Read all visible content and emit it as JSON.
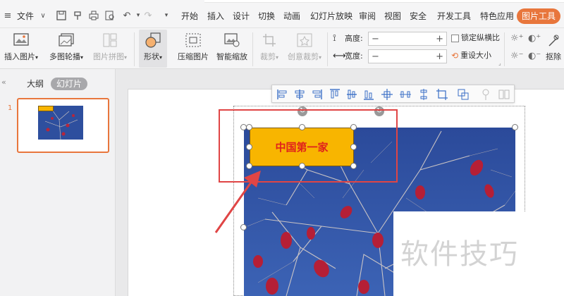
{
  "menubar": {
    "file_label": "文件",
    "items": [
      "开始",
      "插入",
      "设计",
      "切换",
      "动画",
      "幻灯片放映",
      "审阅",
      "视图",
      "安全",
      "开发工具",
      "特色应用"
    ],
    "picture_tools_tab": "图片工具"
  },
  "ribbon": {
    "insert_picture": "插入图片",
    "multi_carousel": "多图轮播",
    "picture_collage": "图片拼图",
    "shape": "形状",
    "compress_picture": "压缩图片",
    "smart_scale": "智能缩放",
    "crop": "裁剪",
    "creative_crop": "创意裁剪",
    "height_label": "高度:",
    "width_label": "宽度:",
    "height_value": "",
    "width_value": "",
    "lock_ratio": "锁定纵横比",
    "reset_size": "重设大小",
    "remove_bg": "抠除"
  },
  "left_pane": {
    "tab_outline": "大纲",
    "tab_slides": "幻灯片",
    "slide_number": "1"
  },
  "slide": {
    "shape_text": "中国第一家"
  },
  "watermark": "软件技巧",
  "colors": {
    "accent": "#e8763c",
    "shape_fill": "#f8b500",
    "shape_text": "#e0221c",
    "highlight_box": "#e04545",
    "sky": "#2e4f9e"
  }
}
